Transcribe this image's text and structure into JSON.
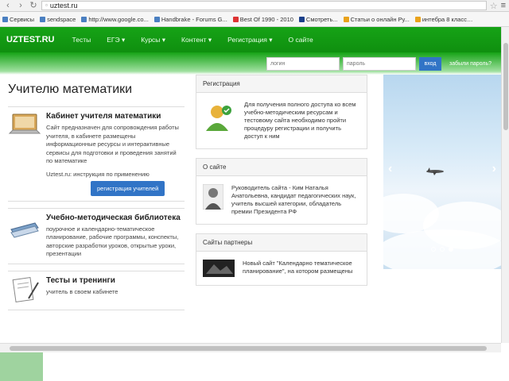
{
  "browser": {
    "url": "uztest.ru",
    "bookmarks": [
      "Сервисы",
      "sendspace",
      "http://www.google.co...",
      "Handbrake - Forums G...",
      "Best Of 1990 - 2010",
      "Смотреть...",
      "Статьи о онлайн Ру...",
      "интебра 8 класс…"
    ]
  },
  "nav": {
    "brand": "UZTEST.RU",
    "items": [
      "Тесты",
      "ЕГЭ ▾",
      "Курсы ▾",
      "Контент ▾",
      "Регистрация ▾",
      "О сайте"
    ]
  },
  "login": {
    "login_placeholder": "логин",
    "password_placeholder": "пароль",
    "submit": "вход",
    "forgot": "забыли пароль?"
  },
  "main": {
    "title": "Учителю математики",
    "features": [
      {
        "title": "Кабинет учителя математики",
        "text": "Сайт предназначен для сопровождения работы учителя, в кабинете размещены информационные ресурсы и интерактивные сервисы для подготовки и проведения занятий по математике",
        "link": "Uztest.ru: инструкция по применению",
        "button": "регистрация учителей"
      },
      {
        "title": "Учебно-методическая библиотека",
        "text": "поурочное и календарно-тематическое планирование, рабочие программы, конспекты, авторские разработки уроков, открытые уроки, презентации"
      },
      {
        "title": "Тесты и тренинги",
        "text": "учитель в своем кабинете"
      }
    ]
  },
  "panels": {
    "registration": {
      "header": "Регистрация",
      "text": "Для получения полного доступа ко всем учебно-методическим ресурсам и тестовому сайта необходимо пройти процедуру регистрации и получить доступ к ним"
    },
    "about": {
      "header": "О сайте",
      "text": "Руководитель сайта - Ким Наталья Анатольевна, кандидат педагогических наук, учитель высшей категории, обладатель премии Президента РФ"
    },
    "partners": {
      "header": "Сайты партнеры",
      "text": "Новый сайт \"Календарно тематическое планирование\", на котором размещены"
    }
  },
  "slider": {
    "slides": 3,
    "active": 3
  },
  "colors": {
    "nav_green": "#16a316",
    "button_blue": "#3174c6"
  }
}
